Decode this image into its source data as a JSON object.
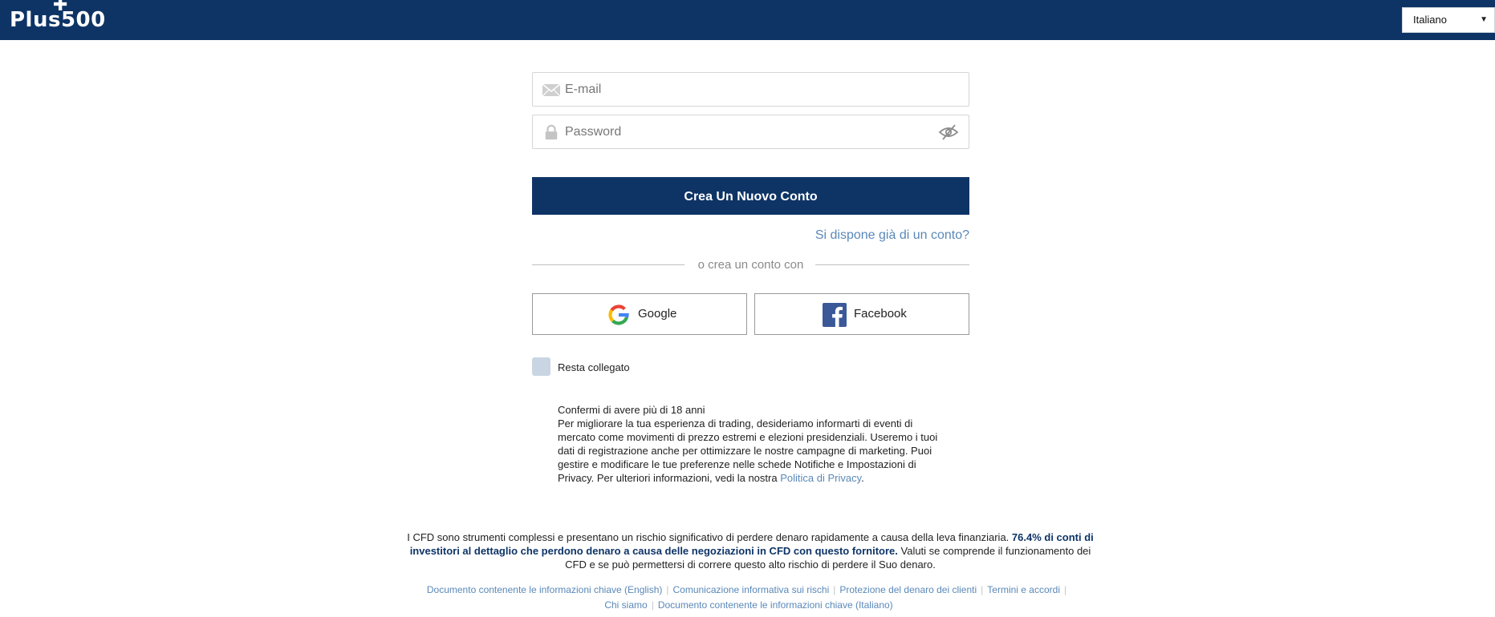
{
  "header": {
    "logo_text": "Plus500",
    "language": "Italiano"
  },
  "form": {
    "email_placeholder": "E-mail",
    "password_placeholder": "Password",
    "create_button": "Crea Un Nuovo Conto",
    "have_account_link": "Si dispone già di un conto?",
    "divider_text": "o crea un conto con",
    "google_label": "Google",
    "facebook_label": "Facebook",
    "stay_logged_label": "Resta collegato"
  },
  "consent": {
    "age": "Confermi di avere più di 18 anni",
    "lines": [
      "Per migliorare la tua esperienza di trading, desideriamo informarti di eventi di",
      "mercato come movimenti di prezzo estremi e elezioni presidenziali. Useremo i tuoi",
      "dati di registrazione anche per ottimizzare le nostre campagne di marketing. Puoi",
      "gestire e modificare le tue preferenze nelle schede Notifiche e Impostazioni di"
    ],
    "last_prefix": "Privacy. Per ulteriori informazioni, vedi la nostra ",
    "privacy_link": "Politica di Privacy",
    "last_suffix": "."
  },
  "risk": {
    "text_before": "I CFD sono strumenti complessi e presentano un rischio significativo di perdere denaro rapidamente a causa della leva finanziaria. ",
    "bold": "76.4% di conti di investitori al dettaglio che perdono denaro a causa delle negoziazioni in CFD con questo fornitore.",
    "text_after": " Valuti se comprende il funzionamento dei CFD e se può permettersi di correre questo alto rischio di perdere il Suo denaro."
  },
  "footer_links": {
    "kid_en": "Documento contenente le informazioni chiave (English)",
    "risk_disclosure": "Comunicazione informativa sui rischi",
    "client_money": "Protezione del denaro dei clienti",
    "terms": "Termini e accordi",
    "about": "Chi siamo",
    "kid_it": "Documento contenente le informazioni chiave (Italiano)"
  },
  "colors": {
    "brand_navy": "#0e3466",
    "link_blue": "#5a88b8",
    "facebook_blue": "#3b5998",
    "google_blue": "#4285f4",
    "google_red": "#ea4335",
    "google_yellow": "#fbbc05",
    "google_green": "#34a853"
  },
  "icons": {
    "email": "envelope-icon",
    "password": "lock-icon",
    "visibility": "eye-slash-icon",
    "google": "google-g-icon",
    "facebook": "facebook-f-icon",
    "language_dropdown": "caret-down-icon"
  }
}
